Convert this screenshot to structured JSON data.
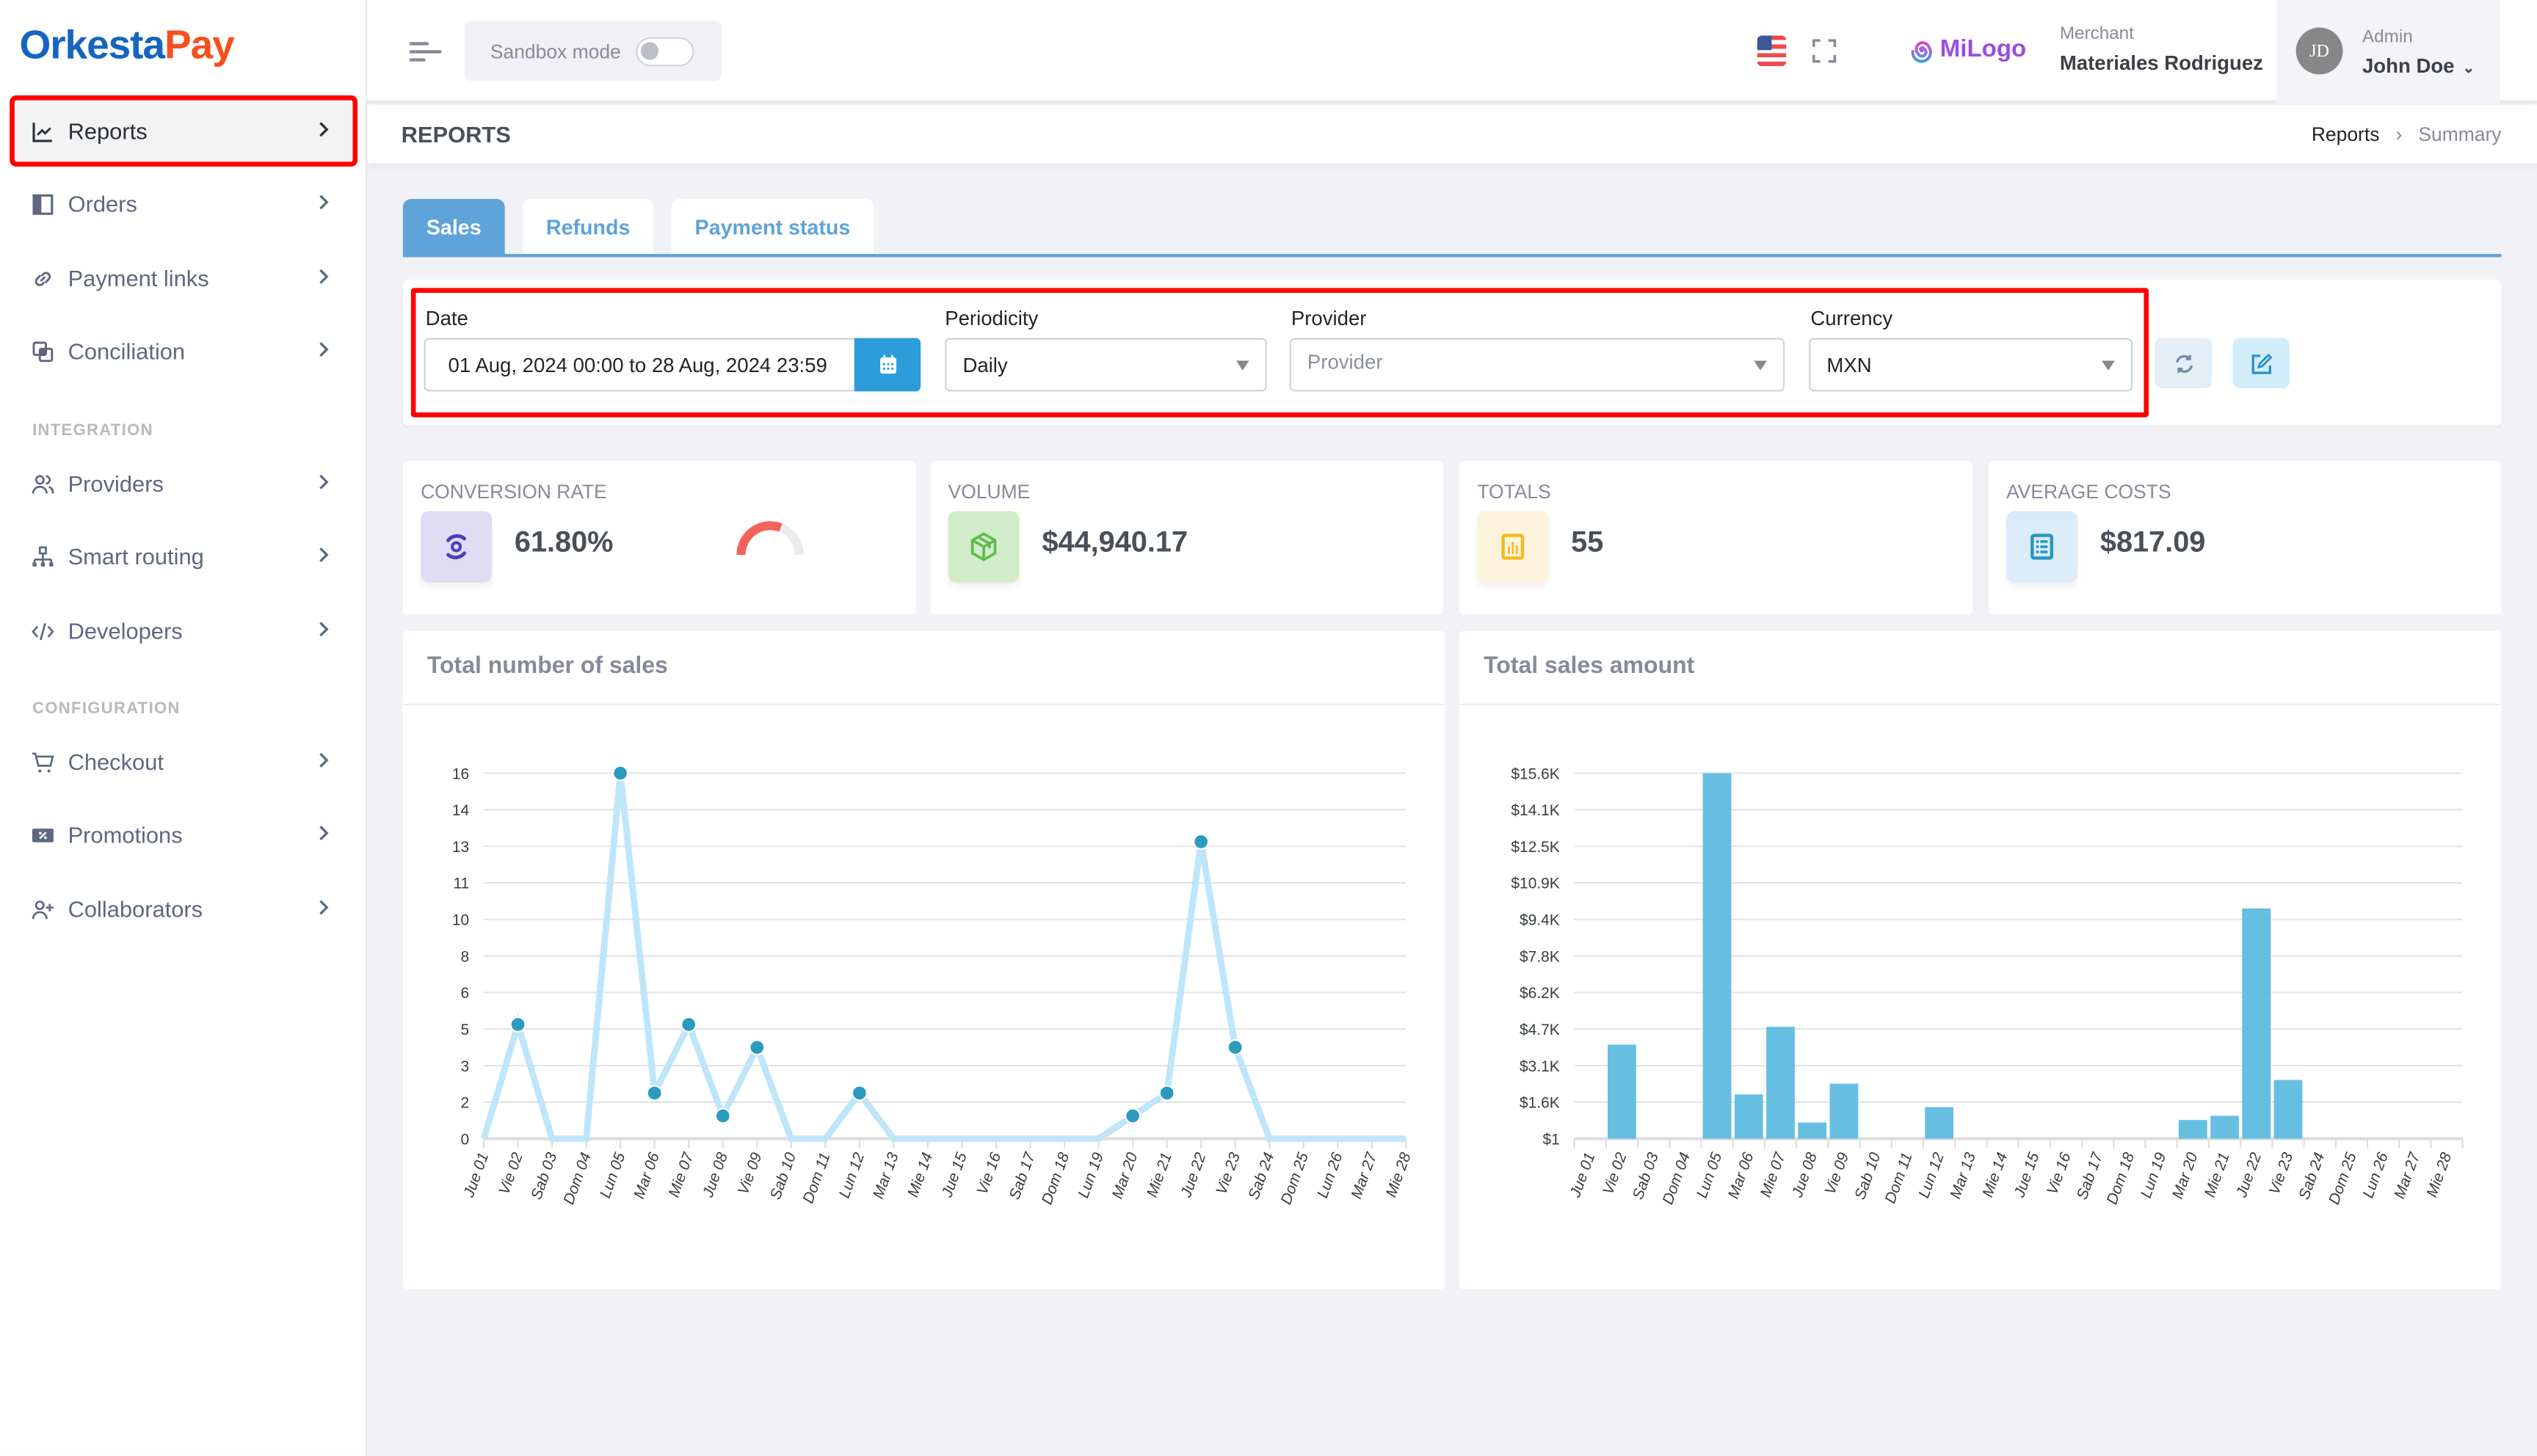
{
  "brand": {
    "part1": "Orkesta",
    "part2": "Pay"
  },
  "sidebar": {
    "items": [
      {
        "label": "Reports",
        "icon": "chart-line-icon",
        "active": true
      },
      {
        "label": "Orders",
        "icon": "book-icon"
      },
      {
        "label": "Payment links",
        "icon": "link-icon"
      },
      {
        "label": "Conciliation",
        "icon": "copy-icon"
      }
    ],
    "integration_label": "INTEGRATION",
    "integration_items": [
      {
        "label": "Providers",
        "icon": "users-icon"
      },
      {
        "label": "Smart routing",
        "icon": "sitemap-icon"
      },
      {
        "label": "Developers",
        "icon": "code-icon"
      }
    ],
    "configuration_label": "CONFIGURATION",
    "configuration_items": [
      {
        "label": "Checkout",
        "icon": "cart-icon"
      },
      {
        "label": "Promotions",
        "icon": "coupon-icon"
      },
      {
        "label": "Collaborators",
        "icon": "user-add-icon"
      }
    ]
  },
  "header": {
    "sandbox_label": "Sandbox mode",
    "sandbox_enabled": false,
    "language": "en-US",
    "merchant_logo_text": "MiLogo",
    "merchant_label": "Merchant",
    "merchant_name": "Materiales Rodriguez",
    "user_initials": "JD",
    "user_role": "Admin",
    "user_name": "John Doe"
  },
  "page": {
    "title": "REPORTS",
    "breadcrumb": [
      "Reports",
      "Summary"
    ]
  },
  "tabs": [
    {
      "label": "Sales",
      "active": true
    },
    {
      "label": "Refunds",
      "active": false
    },
    {
      "label": "Payment status",
      "active": false
    }
  ],
  "filters": {
    "date_label": "Date",
    "date_value": "01 Aug, 2024 00:00 to 28 Aug, 2024 23:59",
    "periodicity_label": "Periodicity",
    "periodicity_value": "Daily",
    "provider_label": "Provider",
    "provider_placeholder": "Provider",
    "currency_label": "Currency",
    "currency_value": "MXN"
  },
  "stats": [
    {
      "label": "CONVERSION RATE",
      "value": "61.80%",
      "gauge_fraction": 0.618,
      "icon": "conversion-icon",
      "bg": "#dfdcf3",
      "fg": "#4a3fb5"
    },
    {
      "label": "VOLUME",
      "value": "$44,940.17",
      "icon": "box-icon",
      "bg": "#d1ecc9",
      "fg": "#5cbb4a"
    },
    {
      "label": "TOTALS",
      "value": "55",
      "icon": "bar-report-icon",
      "bg": "#fdf3dc",
      "fg": "#f5b91c"
    },
    {
      "label": "AVERAGE COSTS",
      "value": "$817.09",
      "icon": "list-report-icon",
      "bg": "#dbebf7",
      "fg": "#2596be"
    }
  ],
  "colors": {
    "accent": "#5ea3d9",
    "line": "#bfe5fa",
    "marker": "#2a9bbf",
    "bar": "#66bfe0",
    "gauge": "#f4625b",
    "gauge_track": "#ebebeb"
  },
  "chart_data": [
    {
      "type": "line",
      "title": "Total number of sales",
      "categories": [
        "Jue 01",
        "Vie 02",
        "Sab 03",
        "Dom 04",
        "Lun 05",
        "Mar 06",
        "Mie 07",
        "Jue 08",
        "Vie 09",
        "Sab 10",
        "Dom 11",
        "Lun 12",
        "Mar 13",
        "Mie 14",
        "Jue 15",
        "Vie 16",
        "Sab 17",
        "Dom 18",
        "Lun 19",
        "Mar 20",
        "Mie 21",
        "Jue 22",
        "Vie 23",
        "Sab 24",
        "Dom 25",
        "Lun 26",
        "Mar 27",
        "Mie 28"
      ],
      "values": [
        0,
        5,
        0,
        0,
        16,
        2,
        5,
        1,
        4,
        0,
        0,
        2,
        0,
        0,
        0,
        0,
        0,
        0,
        0,
        1,
        2,
        13,
        4,
        0,
        0,
        0,
        0,
        0
      ],
      "ylim": [
        0,
        16
      ],
      "yticks": [
        "0",
        "2",
        "3",
        "5",
        "6",
        "8",
        "10",
        "11",
        "13",
        "14",
        "16"
      ],
      "xlabel": "",
      "ylabel": "",
      "grid": true
    },
    {
      "type": "bar",
      "title": "Total sales amount",
      "categories": [
        "Jue 01",
        "Vie 02",
        "Sab 03",
        "Dom 04",
        "Lun 05",
        "Mar 06",
        "Mie 07",
        "Jue 08",
        "Vie 09",
        "Sab 10",
        "Dom 11",
        "Lun 12",
        "Mar 13",
        "Mie 14",
        "Jue 15",
        "Vie 16",
        "Sab 17",
        "Dom 18",
        "Lun 19",
        "Mar 20",
        "Mie 21",
        "Jue 22",
        "Vie 23",
        "Sab 24",
        "Dom 25",
        "Lun 26",
        "Mar 27",
        "Mie 28"
      ],
      "values": [
        0,
        4015,
        0,
        0,
        15600,
        1890,
        4775,
        690,
        2350,
        0,
        0,
        1350,
        0,
        0,
        0,
        0,
        0,
        0,
        0,
        800,
        980,
        9830,
        2510,
        0,
        0,
        0,
        0,
        0
      ],
      "ylim": [
        1,
        15601
      ],
      "yticks": [
        "$1",
        "$1.6K",
        "$3.1K",
        "$4.7K",
        "$6.2K",
        "$7.8K",
        "$9.4K",
        "$10.9K",
        "$12.5K",
        "$14.1K",
        "$15.6K"
      ],
      "xlabel": "",
      "ylabel": "",
      "grid": true
    }
  ]
}
